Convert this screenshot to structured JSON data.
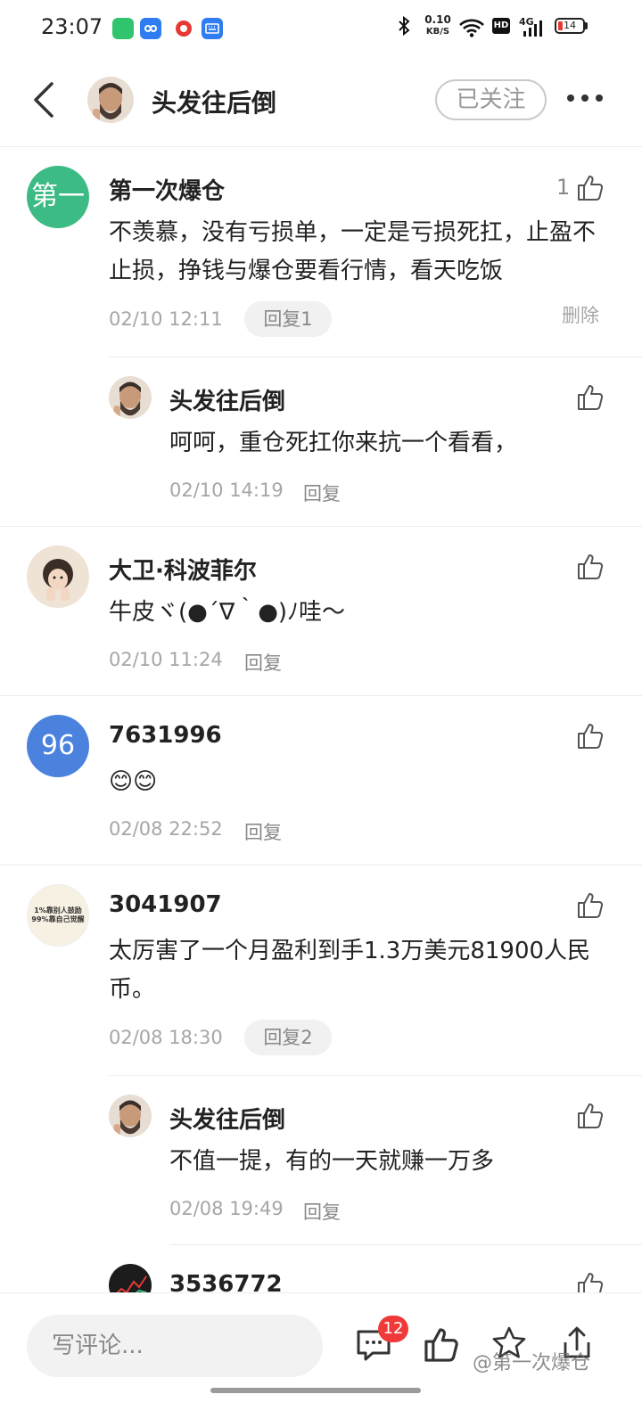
{
  "status_bar": {
    "time": "23:07",
    "net_rate_value": "0.10",
    "net_rate_unit": "KB/S",
    "hd": "HD",
    "signal": "4G",
    "battery": "14"
  },
  "header": {
    "user_name": "头发往后倒",
    "follow_label": "已关注"
  },
  "comments": [
    {
      "name": "第一次爆仓",
      "avatar_text": "第一",
      "avatar_color": "#3dbb84",
      "text": "不羡慕，没有亏损单，一定是亏损死扛，止盈不止损，挣钱与爆仓要看行情，看天吃饭",
      "time": "02/10 12:11",
      "reply_label": "回复1",
      "like_count": "1",
      "delete_label": "删除",
      "replies": [
        {
          "name": "头发往后倒",
          "text": "呵呵，重仓死扛你来抗一个看看，",
          "time": "02/10 14:19",
          "reply_label": "回复"
        }
      ]
    },
    {
      "name": "大卫·科波菲尔",
      "text": "牛皮ヾ(●´∇｀●)ﾉ哇～",
      "time": "02/10 11:24",
      "reply_label": "回复"
    },
    {
      "name": "7631996",
      "avatar_text": "96",
      "avatar_color": "#4a82de",
      "text": "😊😊",
      "time": "02/08 22:52",
      "reply_label": "回复"
    },
    {
      "name": "3041907",
      "avatar_line1": "1%靠别人鼓励",
      "avatar_line2": "99%靠自己觉醒",
      "text": "太厉害了一个月盈利到手1.3万美元81900人民币。",
      "time": "02/08 18:30",
      "reply_label": "回复2",
      "replies": [
        {
          "name": "头发往后倒",
          "text": "不值一提，有的一天就赚一万多",
          "time": "02/08 19:49",
          "reply_label": "回复"
        },
        {
          "name": "3536772"
        }
      ]
    }
  ],
  "bottom_bar": {
    "input_placeholder": "写评论...",
    "comment_count_badge": "12",
    "watermark": "@第一次爆仓"
  },
  "colors": {
    "accent_red": "#f03a3a",
    "muted_text": "#a6a6a6"
  }
}
